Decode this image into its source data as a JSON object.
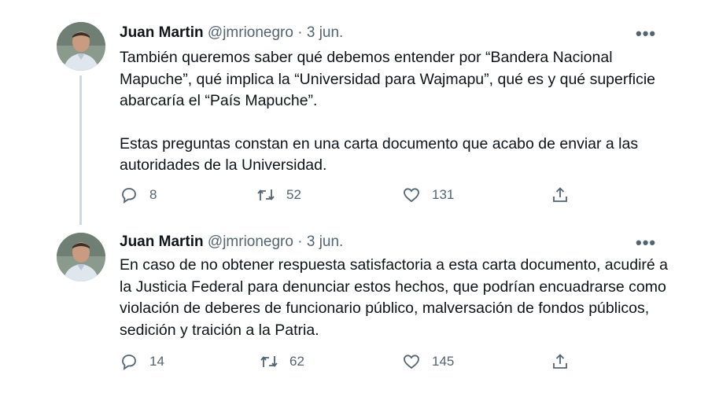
{
  "tweets": [
    {
      "author": "Juan Martin",
      "handle": "@jmrionegro",
      "separator": "·",
      "date": "3 jun.",
      "paragraphs": [
        "También queremos saber qué debemos entender por “Bandera Nacional Mapuche”, qué implica la “Universidad para Wajmapu”, qué es y qué superficie abarcaría el “País Mapuche”.",
        "Estas preguntas constan en una carta documento que acabo de enviar a las autoridades de la Universidad."
      ],
      "replies": "8",
      "retweets": "52",
      "likes": "131"
    },
    {
      "author": "Juan Martin",
      "handle": "@jmrionegro",
      "separator": "·",
      "date": "3 jun.",
      "paragraphs": [
        "En caso de no obtener respuesta satisfactoria a esta carta documento, acudiré a la Justicia Federal para denunciar estos hechos, que podrían encuadrarse como violación de deberes de funcionario público, malversación de fondos públicos, sedición y traición a la Patria."
      ],
      "replies": "14",
      "retweets": "62",
      "likes": "145"
    }
  ],
  "more_glyph": "•••",
  "icons": {
    "reply": "reply-icon",
    "retweet": "retweet-icon",
    "like": "heart-icon",
    "share": "share-icon",
    "more": "more-icon"
  }
}
